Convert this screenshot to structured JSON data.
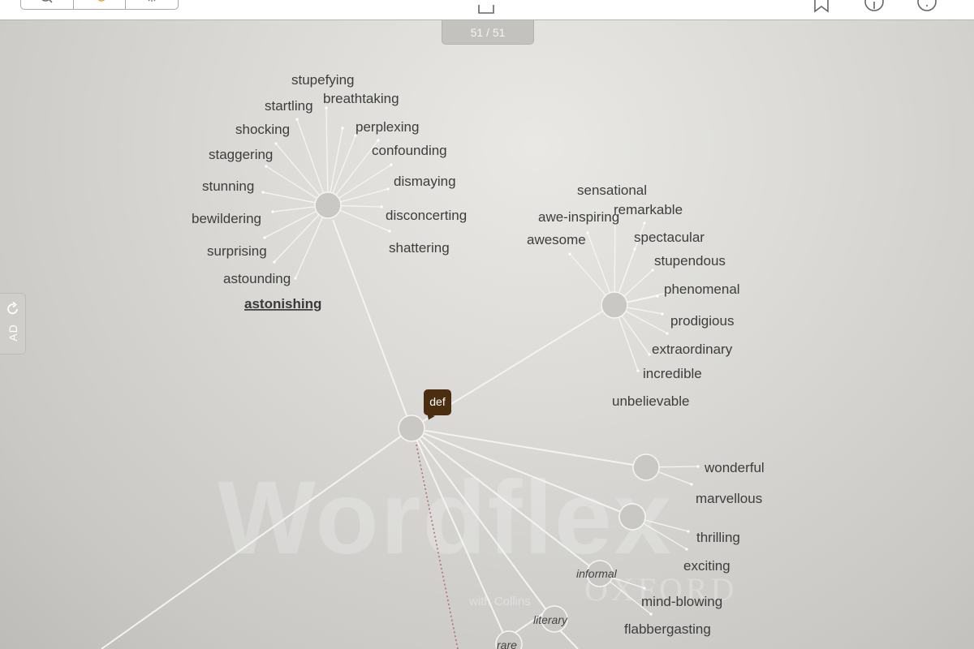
{
  "toolbar": {
    "icons": [
      "search-icon",
      "history-icon",
      "sparkle-icon",
      "bookmark-icon",
      "info-icon",
      "help-icon",
      "share-icon"
    ]
  },
  "page_counter": "51 / 51",
  "ad_tab": {
    "label": "AD"
  },
  "def_badge": "def",
  "watermark": {
    "title": "Wordflex",
    "subtitle": "with Collins",
    "edition": "OXFORD"
  },
  "current_word": "astonishing",
  "clusters": {
    "top": [
      "stupefying",
      "breathtaking",
      "startling",
      "perplexing",
      "shocking",
      "confounding",
      "staggering",
      "dismaying",
      "stunning",
      "disconcerting",
      "bewildering",
      "shattering",
      "surprising",
      "astounding",
      "astonishing"
    ],
    "right": [
      "sensational",
      "remarkable",
      "awe-inspiring",
      "awesome",
      "spectacular",
      "stupendous",
      "phenomenal",
      "prodigious",
      "extraordinary",
      "incredible",
      "unbelievable"
    ],
    "wonderful": [
      "wonderful",
      "marvellous"
    ],
    "thrilling": [
      "thrilling",
      "exciting"
    ],
    "informal": [
      "mind-blowing",
      "flabbergasting"
    ]
  },
  "registers": {
    "informal": "informal",
    "literary": "literary",
    "rare": "rare"
  }
}
